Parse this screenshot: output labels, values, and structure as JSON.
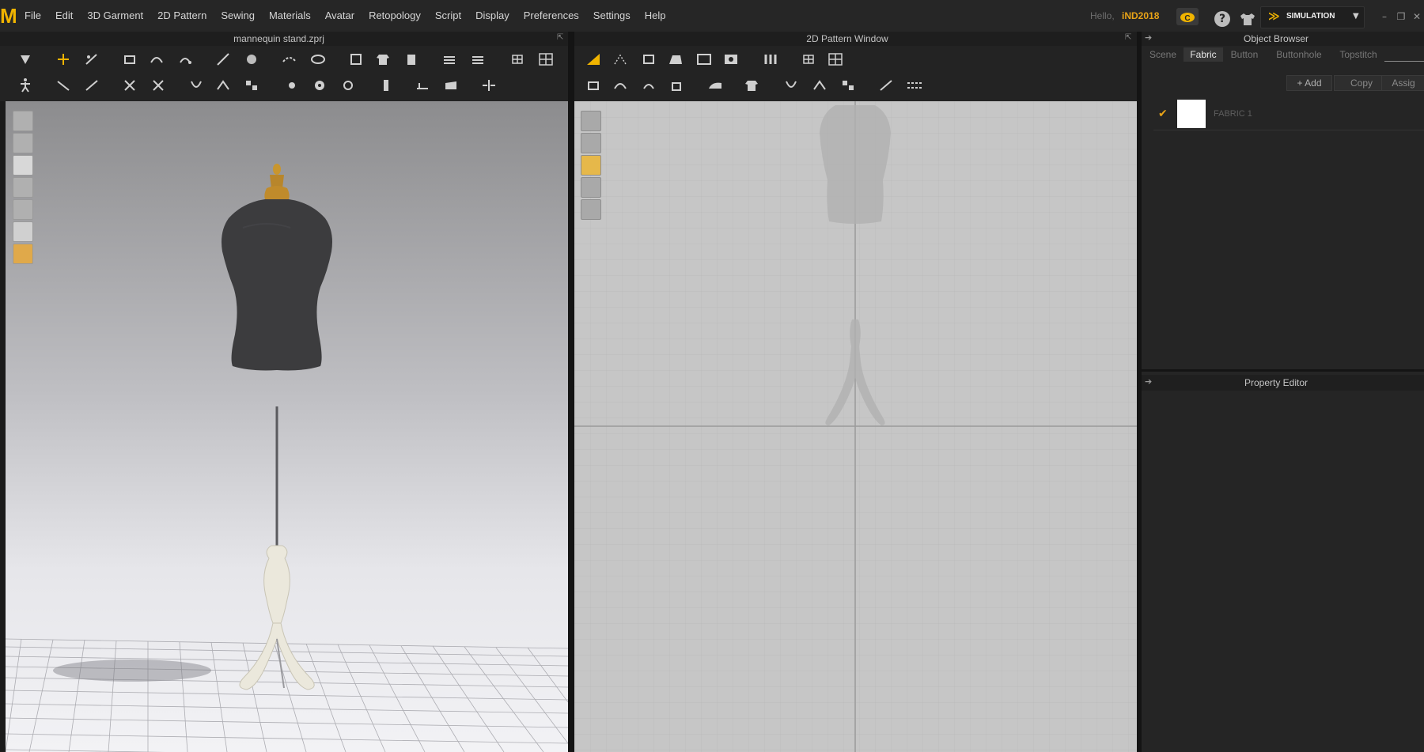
{
  "menubar": {
    "logo": "M",
    "items": [
      "File",
      "Edit",
      "3D Garment",
      "2D Pattern",
      "Sewing",
      "Materials",
      "Avatar",
      "Retopology",
      "Script",
      "Display",
      "Preferences",
      "Settings",
      "Help"
    ],
    "greeting": "Hello,",
    "user": "iND2018",
    "simulation_label": "SIMULATION"
  },
  "panel3d": {
    "title": "mannequin stand.zprj"
  },
  "panel2d": {
    "title": "2D Pattern Window"
  },
  "object_browser": {
    "title": "Object Browser",
    "tabs": [
      "Scene",
      "Fabric",
      "Button",
      "Buttonhole",
      "Topstitch"
    ],
    "active_tab": "Fabric",
    "buttons": {
      "add": "+ Add",
      "copy": "Copy",
      "assign": "Assig"
    },
    "fabrics": [
      {
        "name": "FABRIC 1",
        "color": "#ffffff",
        "checked": true
      }
    ]
  },
  "property_editor": {
    "title": "Property Editor"
  },
  "colors": {
    "accent": "#f0b400",
    "user": "#e8a317",
    "background": "#1b1b1b"
  }
}
